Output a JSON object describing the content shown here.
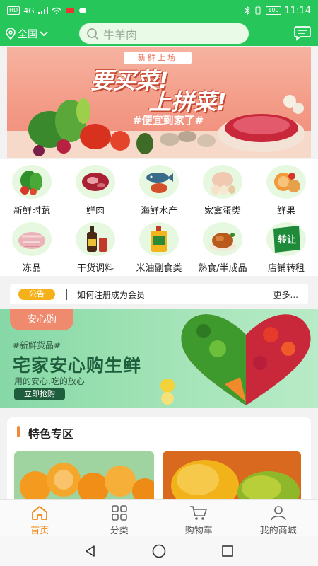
{
  "status_bar": {
    "hd": "HD",
    "signal": "4G",
    "battery": "100",
    "time": "11:14"
  },
  "header": {
    "location": "全国",
    "search_placeholder": "牛羊肉"
  },
  "banner": {
    "tag": "新鲜上场",
    "line1": "要买菜!",
    "line2": "上拼菜!",
    "line3": "#便宜到家了#"
  },
  "categories": [
    {
      "label": "新鲜时蔬",
      "icon": "vegetable-icon"
    },
    {
      "label": "鲜肉",
      "icon": "meat-icon"
    },
    {
      "label": "海鲜水产",
      "icon": "seafood-icon"
    },
    {
      "label": "家禽蛋类",
      "icon": "poultry-egg-icon"
    },
    {
      "label": "鲜果",
      "icon": "fruit-icon"
    },
    {
      "label": "冻品",
      "icon": "frozen-icon"
    },
    {
      "label": "干货调料",
      "icon": "seasoning-icon"
    },
    {
      "label": "米油副食类",
      "icon": "rice-oil-icon"
    },
    {
      "label": "熟食/半成品",
      "icon": "cooked-food-icon"
    },
    {
      "label": "店铺转租",
      "icon": "shop-transfer-icon"
    }
  ],
  "shop_transfer_badge": "转让",
  "notice": {
    "badge": "公告",
    "text": "如何注册成为会员",
    "more": "更多..."
  },
  "promo": {
    "tab": "安心购",
    "tag": "#新鲜货品#",
    "title": "宅家安心购生鲜",
    "subtitle": "用的安心,吃的放心",
    "button": "立即抢购"
  },
  "featured": {
    "title": "特色专区"
  },
  "bottom_nav": [
    {
      "label": "首页",
      "icon": "home-icon",
      "active": true
    },
    {
      "label": "分类",
      "icon": "category-icon",
      "active": false
    },
    {
      "label": "购物车",
      "icon": "cart-icon",
      "active": false
    },
    {
      "label": "我的商城",
      "icon": "user-icon",
      "active": false
    }
  ],
  "colors": {
    "brand_green": "#27c65a",
    "accent_orange": "#f08a1a",
    "notice_badge": "#f5b11a"
  }
}
